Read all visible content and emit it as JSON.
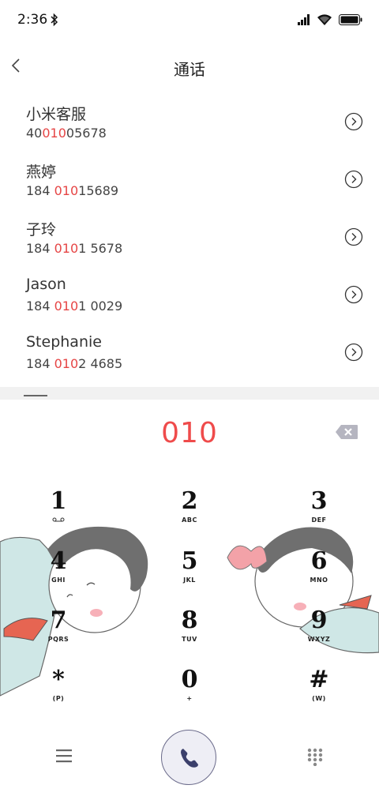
{
  "status": {
    "time": "2:36"
  },
  "header": {
    "title": "通话"
  },
  "contacts": [
    {
      "name": "小米客服",
      "num_pre": "40",
      "num_hl": "010",
      "num_post": "05678"
    },
    {
      "name": "燕婷",
      "num_pre": "184 ",
      "num_hl": "010",
      "num_post": "15689"
    },
    {
      "name": "子玲",
      "num_pre": "184 ",
      "num_hl": "010",
      "num_post": "1 5678"
    },
    {
      "name": "Jason",
      "num_pre": "184 ",
      "num_hl": "010",
      "num_post": "1 0029"
    },
    {
      "name": "Stephanie",
      "num_pre": "184 ",
      "num_hl": "010",
      "num_post": "2 4685"
    }
  ],
  "dialer": {
    "dialed": "010",
    "keys": [
      {
        "digit": "1",
        "letters": ""
      },
      {
        "digit": "2",
        "letters": "ABC"
      },
      {
        "digit": "3",
        "letters": "DEF"
      },
      {
        "digit": "4",
        "letters": "GHI"
      },
      {
        "digit": "5",
        "letters": "JKL"
      },
      {
        "digit": "6",
        "letters": "MNO"
      },
      {
        "digit": "7",
        "letters": "PQRS"
      },
      {
        "digit": "8",
        "letters": "TUV"
      },
      {
        "digit": "9",
        "letters": "WXYZ"
      },
      {
        "digit": "*",
        "letters": "(P)"
      },
      {
        "digit": "0",
        "letters": "+"
      },
      {
        "digit": "#",
        "letters": "(W)"
      }
    ]
  },
  "icons": {
    "back": "chevron-left-icon",
    "detail": "chevron-right-circle-icon",
    "backspace": "backspace-icon",
    "menu": "menu-icon",
    "call": "phone-icon",
    "keypad": "keypad-icon"
  },
  "colors": {
    "highlight": "#e64545",
    "dialed": "#ef4b4b",
    "call_bg": "#eeeef5"
  }
}
